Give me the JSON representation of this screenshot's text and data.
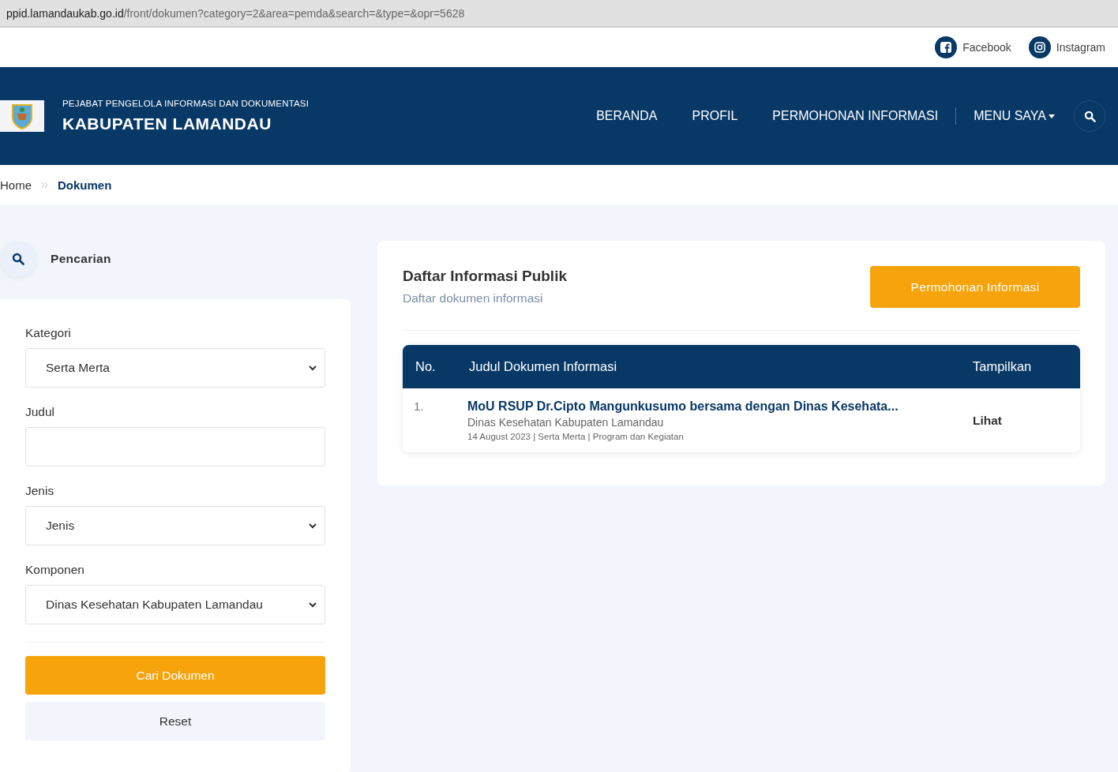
{
  "address_bar": {
    "host": "ppid.lamandaukab.go.id",
    "path": "/front/dokumen?category=2&area=pemda&search=&type=&opr=5628"
  },
  "social_links": [
    {
      "kind": "facebook",
      "label": "Facebook"
    },
    {
      "kind": "instagram",
      "label": "Instagram"
    }
  ],
  "header": {
    "subtitle": "PEJABAT PENGELOLA INFORMASI DAN DOKUMENTASI",
    "title": "KABUPATEN LAMANDAU"
  },
  "nav": [
    {
      "label": "BERANDA",
      "kind": "link"
    },
    {
      "label": "PROFIL",
      "kind": "link"
    },
    {
      "label": "PERMOHONAN INFORMASI",
      "kind": "link"
    },
    {
      "label": "MENU SAYA",
      "kind": "dropdown"
    }
  ],
  "breadcrumb": [
    {
      "label": "Home",
      "current": false
    },
    {
      "label": "Dokumen",
      "current": true
    }
  ],
  "search_panel": {
    "title": "Pencarian",
    "fields": [
      {
        "label": "Kategori",
        "kind": "select",
        "value": "Serta Merta"
      },
      {
        "label": "Judul",
        "kind": "text"
      },
      {
        "label": "Jenis",
        "kind": "select",
        "value": "Jenis"
      },
      {
        "label": "Komponen",
        "kind": "select",
        "value": "Dinas Kesehatan Kabupaten Lamandau"
      }
    ],
    "submit": "Cari Dokumen",
    "reset": "Reset"
  },
  "content": {
    "title": "Daftar Informasi Publik",
    "subtitle": "Daftar dokumen informasi",
    "action": "Permohonan Informasi",
    "table": {
      "columns": [
        "No.",
        "Judul Dokumen Informasi",
        "Tampilkan"
      ],
      "rows": [
        {
          "no": "1.",
          "title": "MoU RSUP Dr.Cipto Mangunkusumo bersama dengan Dinas Kesehata...",
          "agency": "Dinas Kesehatan Kabupaten Lamandau",
          "meta": "14 August 2023 | Serta Merta | Program dan Kegiatan",
          "action": "Lihat"
        }
      ]
    }
  }
}
